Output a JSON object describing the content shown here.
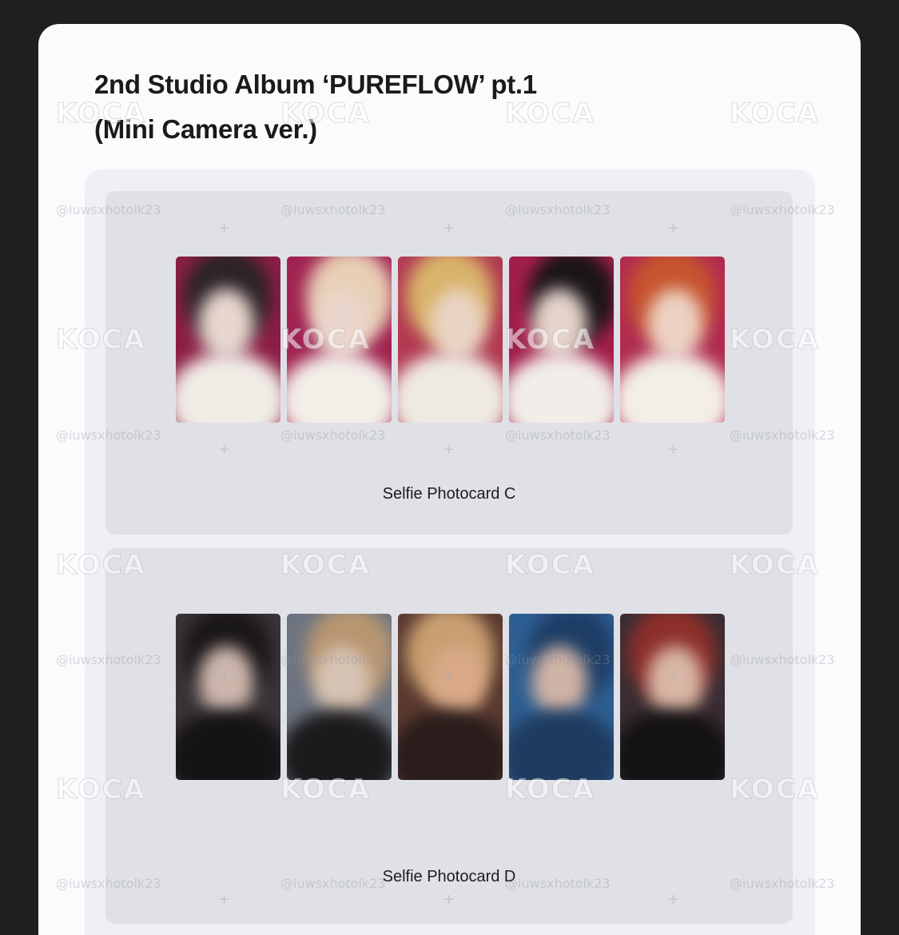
{
  "header": {
    "title_line1": "2nd Studio Album ‘PUREFLOW’ pt.1",
    "title_line2": "(Mini Camera ver.)"
  },
  "sections": [
    {
      "label": "Selfie Photocard C",
      "cards": [
        {
          "bg": "#8c1e45",
          "face": "#e8d6cf",
          "hair": "#2d2428",
          "body": "#f0ece6"
        },
        {
          "bg": "#a02250",
          "face": "#ead6cc",
          "hair": "#e8cfb5",
          "body": "#f2eee8"
        },
        {
          "bg": "#b23a52",
          "face": "#e9d4c4",
          "hair": "#d9b36b",
          "body": "#eeeae2"
        },
        {
          "bg": "#a31e4c",
          "face": "#e6d4cb",
          "hair": "#1b1518",
          "body": "#f1ede8"
        },
        {
          "bg": "#b02c50",
          "face": "#ecd2c2",
          "hair": "#c7542f",
          "body": "#f3eee8"
        }
      ]
    },
    {
      "label": "Selfie Photocard D",
      "cards": [
        {
          "bg": "#3a3438",
          "face": "#cdb7ad",
          "hair": "#1a1719",
          "body": "#151316"
        },
        {
          "bg": "#6d7480",
          "face": "#d6c3b3",
          "hair": "#b89670",
          "body": "#1c1a1c"
        },
        {
          "bg": "#5a3a30",
          "face": "#d9a989",
          "hair": "#c9a071",
          "body": "#2a1d1b"
        },
        {
          "bg": "#2e5f93",
          "face": "#cfb3a6",
          "hair": "#1e3d66",
          "body": "#1f3b60"
        },
        {
          "bg": "#3a2d33",
          "face": "#d8b7a6",
          "hair": "#8e2f2a",
          "body": "#141214"
        }
      ]
    }
  ],
  "watermarks": {
    "logo_text": "KOCA",
    "handle": "@iuwsxhotolk23"
  }
}
